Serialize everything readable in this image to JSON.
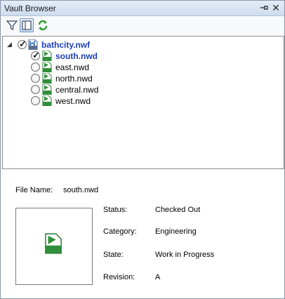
{
  "window": {
    "title": "Vault Browser"
  },
  "toolbar": {
    "buttons": [
      {
        "icon": "filter-icon"
      },
      {
        "icon": "panel-layout-icon"
      },
      {
        "icon": "refresh-icon"
      }
    ]
  },
  "tree": {
    "root": {
      "label": "bathcity.nwf",
      "icon_text": "NWF",
      "checked": true,
      "expanded": true
    },
    "children": [
      {
        "label": "south.nwd",
        "icon_text": "NWD",
        "checked": true,
        "selected": true
      },
      {
        "label": "east.nwd",
        "icon_text": "NWD",
        "checked": false
      },
      {
        "label": "north.nwd",
        "icon_text": "NWD",
        "checked": false
      },
      {
        "label": "central.nwd",
        "icon_text": "NWD",
        "checked": false
      },
      {
        "label": "west.nwd",
        "icon_text": "NWD",
        "checked": false
      }
    ]
  },
  "details": {
    "file_name_label": "File Name:",
    "file_name": "south.nwd",
    "preview_icon_text": "NWD",
    "fields": [
      {
        "label": "Status:",
        "value": "Checked Out"
      },
      {
        "label": "Category:",
        "value": "Engineering"
      },
      {
        "label": "State:",
        "value": "Work in Progress"
      },
      {
        "label": "Revision:",
        "value": "A"
      }
    ]
  },
  "colors": {
    "accent_text": "#1d3fb8",
    "nwd_icon_green": "#2f8f3a"
  }
}
